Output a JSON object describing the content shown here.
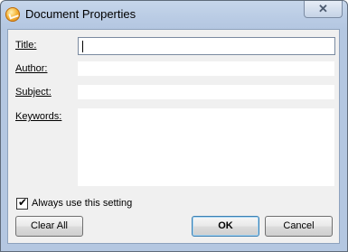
{
  "window": {
    "title": "Document Properties",
    "close_glyph": "✕",
    "icon": "app-icon"
  },
  "form": {
    "title_label": "Title:",
    "title_value": "",
    "author_label": "Author:",
    "author_value": "",
    "subject_label": "Subject:",
    "subject_value": "",
    "keywords_label": "Keywords:",
    "keywords_value": ""
  },
  "options": {
    "always_use_label": "Always use this setting",
    "always_use_checked": true,
    "check_glyph": "✔"
  },
  "buttons": {
    "clear_all": "Clear All",
    "ok": "OK",
    "cancel": "Cancel"
  }
}
